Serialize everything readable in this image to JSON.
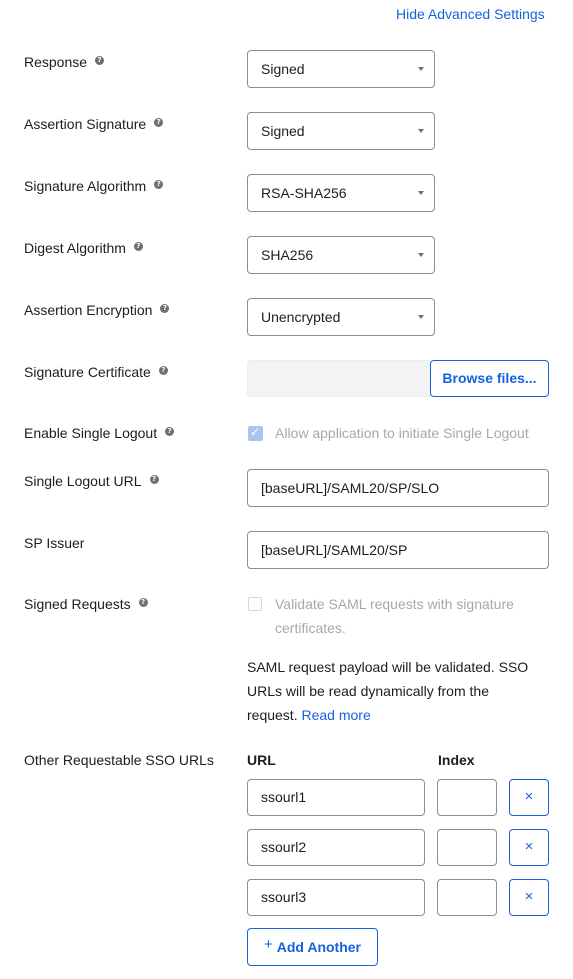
{
  "header": {
    "advanced_toggle": "Hide Advanced Settings"
  },
  "fields": {
    "response": {
      "label": "Response",
      "value": "Signed"
    },
    "assertion_signature": {
      "label": "Assertion Signature",
      "value": "Signed"
    },
    "signature_algorithm": {
      "label": "Signature Algorithm",
      "value": "RSA-SHA256"
    },
    "digest_algorithm": {
      "label": "Digest Algorithm",
      "value": "SHA256"
    },
    "assertion_encryption": {
      "label": "Assertion Encryption",
      "value": "Unencrypted"
    },
    "signature_certificate": {
      "label": "Signature Certificate",
      "file_value": "",
      "browse_label": "Browse files..."
    },
    "single_logout": {
      "label": "Enable Single Logout",
      "checkbox_label": "Allow application to initiate Single Logout",
      "checked": true,
      "disabled": true
    },
    "single_logout_url": {
      "label": "Single Logout URL",
      "value": "[baseURL]/SAML20/SP/SLO"
    },
    "sp_issuer": {
      "label": "SP Issuer",
      "value": "[baseURL]/SAML20/SP"
    },
    "signed_requests": {
      "label": "Signed Requests",
      "checkbox_label_line1": "Validate SAML requests with signature",
      "checkbox_label_line2": "certificates.",
      "checked": false,
      "disabled": true,
      "help_line1": "SAML request payload will be validated. SSO",
      "help_line2": "URLs will be read dynamically from the",
      "help_line3_prefix": "request.",
      "read_more": "Read more"
    },
    "other_sso_urls": {
      "label": "Other Requestable SSO URLs",
      "url_header": "URL",
      "index_header": "Index",
      "rows": [
        {
          "url": "ssourl1",
          "index": "",
          "remove": "×"
        },
        {
          "url": "ssourl2",
          "index": "",
          "remove": "×"
        },
        {
          "url": "ssourl3",
          "index": "",
          "remove": "×"
        }
      ],
      "add_icon": "+",
      "add_label": "Add Another"
    }
  },
  "icons": {
    "help": "?",
    "check": "✓"
  },
  "colors": {
    "link": "#1662dd",
    "border": "#8c8c96",
    "disabled_text": "#a7a7ad",
    "checkbox_checked": "#a9c4ee"
  }
}
